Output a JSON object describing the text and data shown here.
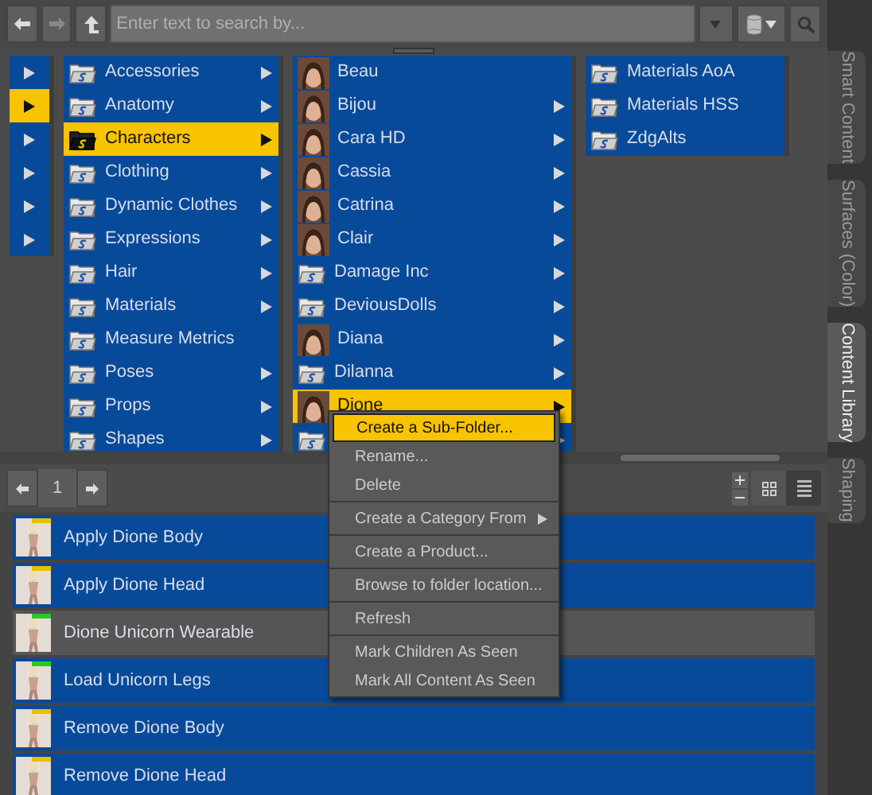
{
  "toolbar": {
    "search": {
      "placeholder": "Enter text to search by..."
    }
  },
  "columns": [
    {
      "items": [
        {
          "selected": false
        },
        {
          "selected": true
        },
        {
          "selected": false
        },
        {
          "selected": false
        },
        {
          "selected": false
        },
        {
          "selected": false
        }
      ]
    },
    {
      "items": [
        {
          "kind": "folder",
          "label": "Accessories",
          "selected": false,
          "has_children": true
        },
        {
          "kind": "folder",
          "label": "Anatomy",
          "selected": false,
          "has_children": true
        },
        {
          "kind": "folder",
          "label": "Characters",
          "selected": true,
          "has_children": true
        },
        {
          "kind": "folder",
          "label": "Clothing",
          "selected": false,
          "has_children": true
        },
        {
          "kind": "folder",
          "label": "Dynamic Clothes",
          "selected": false,
          "has_children": true
        },
        {
          "kind": "folder",
          "label": "Expressions",
          "selected": false,
          "has_children": true
        },
        {
          "kind": "folder",
          "label": "Hair",
          "selected": false,
          "has_children": true
        },
        {
          "kind": "folder",
          "label": "Materials",
          "selected": false,
          "has_children": true
        },
        {
          "kind": "folder",
          "label": "Measure Metrics",
          "selected": false,
          "has_children": false
        },
        {
          "kind": "folder",
          "label": "Poses",
          "selected": false,
          "has_children": true
        },
        {
          "kind": "folder",
          "label": "Props",
          "selected": false,
          "has_children": true
        },
        {
          "kind": "folder",
          "label": "Shapes",
          "selected": false,
          "has_children": true
        }
      ]
    },
    {
      "items": [
        {
          "kind": "face",
          "label": "Beau",
          "selected": false,
          "has_children": false
        },
        {
          "kind": "face",
          "label": "Bijou",
          "selected": false,
          "has_children": true
        },
        {
          "kind": "face",
          "label": "Cara HD",
          "selected": false,
          "has_children": true
        },
        {
          "kind": "face",
          "label": "Cassia",
          "selected": false,
          "has_children": true
        },
        {
          "kind": "face",
          "label": "Catrina",
          "selected": false,
          "has_children": true
        },
        {
          "kind": "face",
          "label": "Clair",
          "selected": false,
          "has_children": true
        },
        {
          "kind": "folder",
          "label": "Damage Inc",
          "selected": false,
          "has_children": true
        },
        {
          "kind": "folder",
          "label": "DeviousDolls",
          "selected": false,
          "has_children": true
        },
        {
          "kind": "face",
          "label": "Diana",
          "selected": false,
          "has_children": true
        },
        {
          "kind": "folder",
          "label": "Dilanna",
          "selected": false,
          "has_children": true
        },
        {
          "kind": "face",
          "label": "Dione",
          "selected": true,
          "has_children": true
        },
        {
          "kind": "folder",
          "selected": false,
          "has_children": true
        }
      ]
    },
    {
      "items": [
        {
          "kind": "folder",
          "label": "Materials AoA",
          "selected": false,
          "has_children": false
        },
        {
          "kind": "folder",
          "label": "Materials HSS",
          "selected": false,
          "has_children": false
        },
        {
          "kind": "folder",
          "label": "ZdgAlts",
          "selected": false,
          "has_children": false
        }
      ]
    }
  ],
  "pager": {
    "page": "1"
  },
  "assets": [
    {
      "label": "Apply Dione Body",
      "selected": true,
      "color": "#e8c000"
    },
    {
      "label": "Apply Dione Head",
      "selected": true,
      "color": "#e8c000"
    },
    {
      "label": "Dione Unicorn Wearable",
      "selected": false,
      "color": "#22cc22"
    },
    {
      "label": "Load Unicorn Legs",
      "selected": true,
      "color": "#22cc22"
    },
    {
      "label": "Remove Dione Body",
      "selected": true,
      "color": "#e8c000"
    },
    {
      "label": "Remove Dione Head",
      "selected": true,
      "color": "#e8c000"
    }
  ],
  "context_menu": {
    "groups": [
      [
        {
          "label": "Create a Sub-Folder...",
          "selected": true,
          "submenu": false
        },
        {
          "label": "Rename...",
          "selected": false,
          "submenu": false
        },
        {
          "label": "Delete",
          "selected": false,
          "submenu": false
        }
      ],
      [
        {
          "label": "Create a Category From",
          "selected": false,
          "submenu": true
        }
      ],
      [
        {
          "label": "Create a Product...",
          "selected": false,
          "submenu": false
        }
      ],
      [
        {
          "label": "Browse to folder location...",
          "selected": false,
          "submenu": false
        }
      ],
      [
        {
          "label": "Refresh",
          "selected": false,
          "submenu": false
        }
      ],
      [
        {
          "label": "Mark Children As Seen",
          "selected": false,
          "submenu": false
        },
        {
          "label": "Mark All Content As Seen",
          "selected": false,
          "submenu": false
        }
      ]
    ]
  },
  "side_tabs": [
    {
      "label": "Smart Content",
      "selected": false
    },
    {
      "label": "Surfaces (Color)",
      "selected": false
    },
    {
      "label": "Content Library",
      "selected": true
    },
    {
      "label": "Shaping",
      "selected": false
    }
  ]
}
